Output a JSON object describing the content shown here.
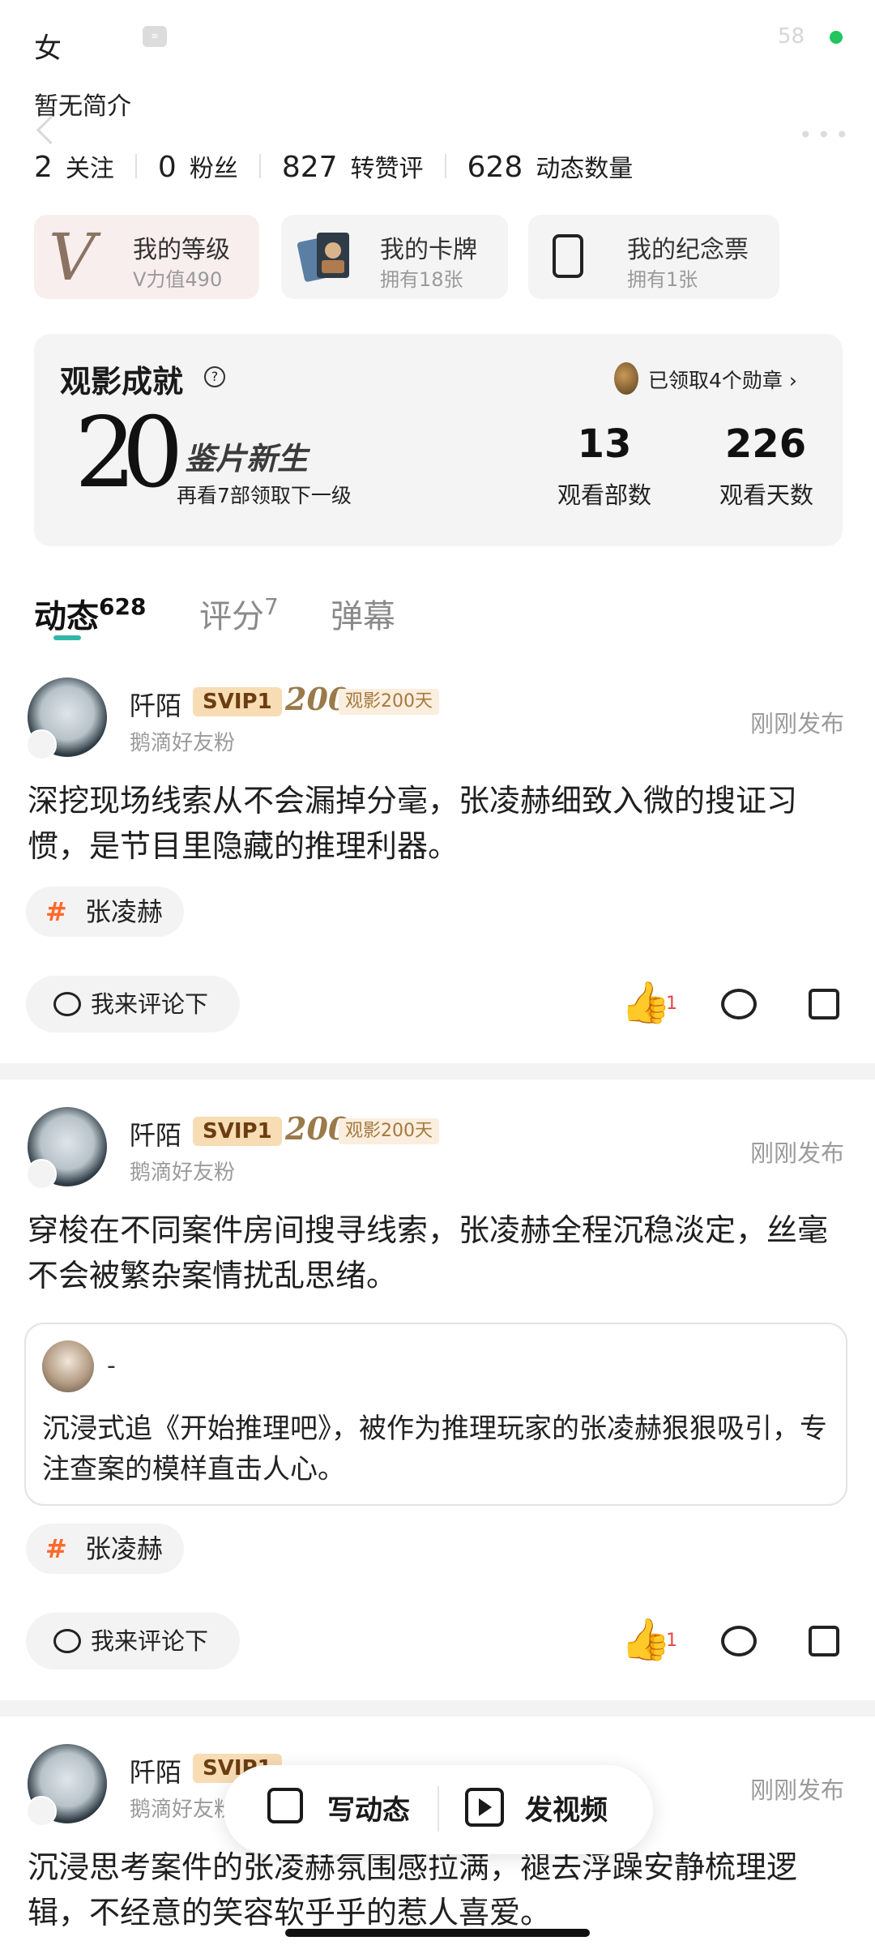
{
  "profile": {
    "gender": "女",
    "intro": "暂无简介",
    "status_time": "58",
    "stats": [
      {
        "num": "2",
        "label": "关注"
      },
      {
        "num": "0",
        "label": "粉丝"
      },
      {
        "num": "827",
        "label": "转赞评"
      },
      {
        "num": "628",
        "label": "动态数量"
      }
    ]
  },
  "cards": [
    {
      "title": "我的等级",
      "sub": "V力值490"
    },
    {
      "title": "我的卡牌",
      "sub": "拥有18张"
    },
    {
      "title": "我的纪念票",
      "sub": "拥有1张"
    }
  ],
  "achievements": {
    "title": "观影成就",
    "medals": "已领取4个勋章 ›",
    "level_number": "20",
    "level_name": "鉴片新生",
    "level_hint": "再看7部领取下一级",
    "watched_count": "13",
    "watched_label": "观看部数",
    "days_count": "226",
    "days_label": "观看天数"
  },
  "tabs": [
    {
      "label": "动态",
      "count": "628"
    },
    {
      "label": "评分",
      "count": "7"
    },
    {
      "label": "弹幕",
      "count": ""
    }
  ],
  "posts": [
    {
      "user": "阡陌",
      "vip": "SVIP1",
      "days_num": "200",
      "days_label": "观影200天",
      "fans": "鹅滴好友粉",
      "time": "刚刚发布",
      "text": "深挖现场线索从不会漏掉分毫，张凌赫细致入微的搜证习惯，是节目里隐藏的推理利器。",
      "hashtag": "张凌赫",
      "comment_placeholder": "我来评论下",
      "likes": "1"
    },
    {
      "user": "阡陌",
      "vip": "SVIP1",
      "days_num": "200",
      "days_label": "观影200天",
      "fans": "鹅滴好友粉",
      "time": "刚刚发布",
      "text": "穿梭在不同案件房间搜寻线索，张凌赫全程沉稳淡定，丝毫不会被繁杂案情扰乱思绪。",
      "quote_name": "-",
      "quote_text": "沉浸式追《开始推理吧》，被作为推理玩家的张凌赫狠狠吸引，专注查案的模样直击人心。",
      "hashtag": "张凌赫",
      "comment_placeholder": "我来评论下",
      "likes": "1"
    },
    {
      "user": "阡陌",
      "vip": "SVIP1",
      "fans": "鹅滴好友粉",
      "time": "刚刚发布",
      "text": "沉浸思考案件的张凌赫氛围感拉满，褪去浮躁安静梳理逻辑，不经意的笑容软乎乎的惹人喜爱。"
    }
  ],
  "float_bar": {
    "write": "写动态",
    "video": "发视频"
  }
}
